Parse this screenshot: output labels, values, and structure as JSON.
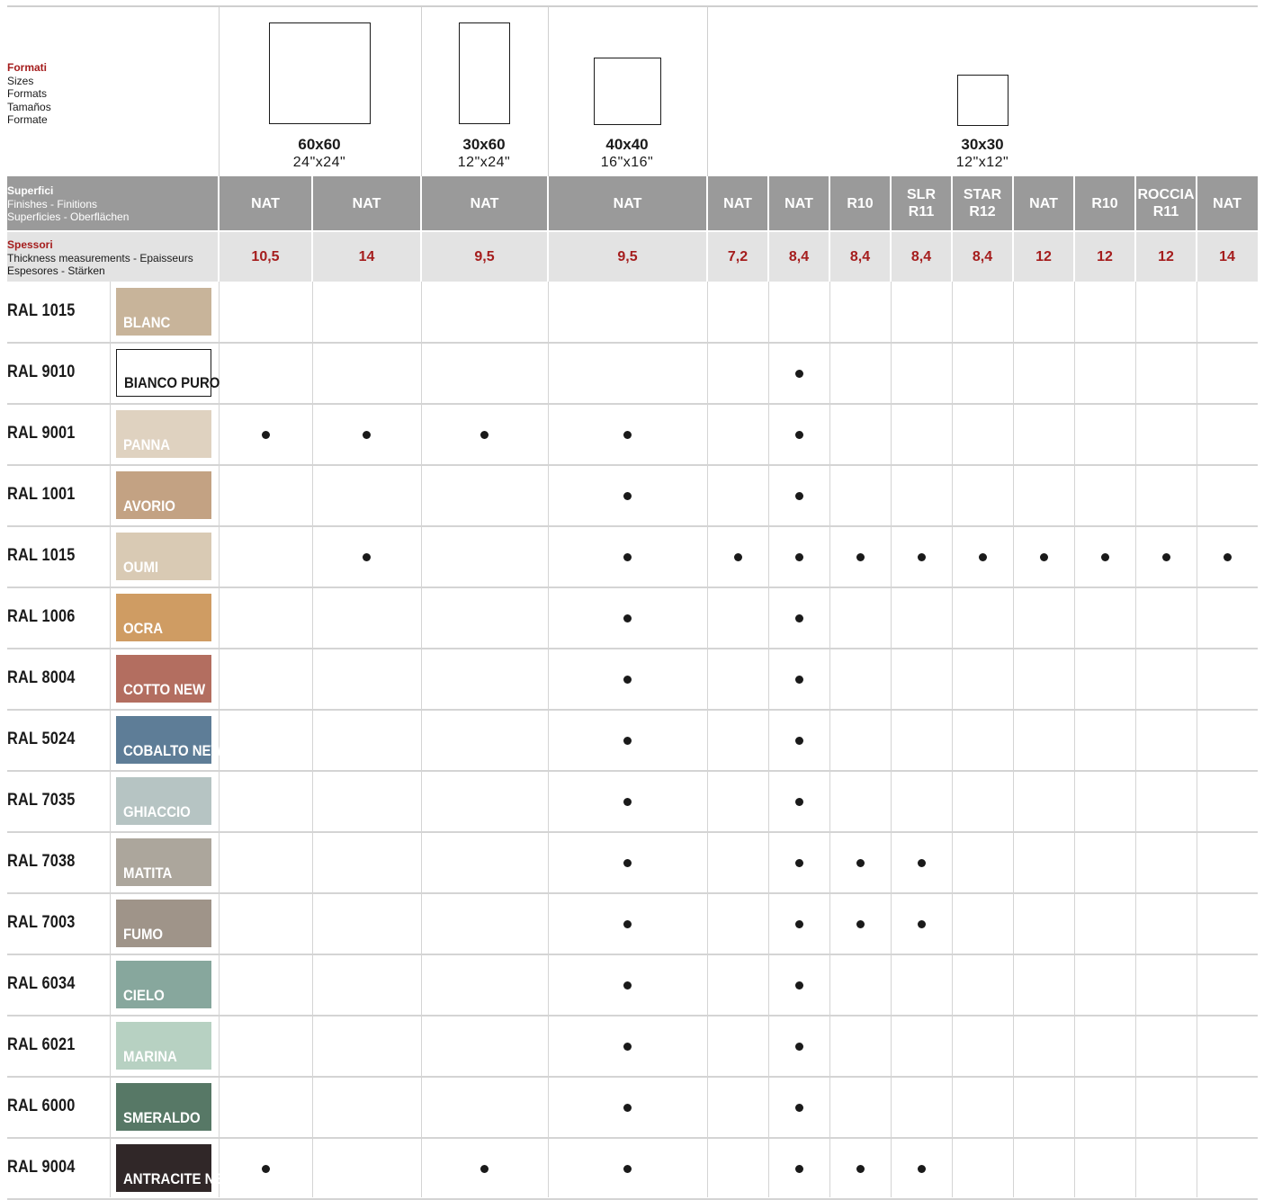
{
  "header": {
    "formats_label": [
      "Formati",
      "Sizes",
      "Formats",
      "Tamaños",
      "Formate"
    ],
    "finishes_label": [
      "Superfici",
      "Finishes - Finitions",
      "Superficies - Oberflächen"
    ],
    "thickness_label": [
      "Spessori",
      "Thickness measurements - Epaisseurs",
      "Espesores - Stärken"
    ]
  },
  "formats": [
    {
      "size": "60x60",
      "inches": "24\"x24\""
    },
    {
      "size": "30x60",
      "inches": "12\"x24\""
    },
    {
      "size": "40x40",
      "inches": "16\"x16\""
    },
    {
      "size": "30x30",
      "inches": "12\"x12\""
    }
  ],
  "columns": [
    {
      "finish": "NAT",
      "thickness": "10,5"
    },
    {
      "finish": "NAT",
      "thickness": "14"
    },
    {
      "finish": "NAT",
      "thickness": "9,5"
    },
    {
      "finish": "NAT",
      "thickness": "9,5"
    },
    {
      "finish": "NAT",
      "thickness": "7,2"
    },
    {
      "finish": "NAT",
      "thickness": "8,4"
    },
    {
      "finish": "R10",
      "thickness": "8,4"
    },
    {
      "finish": "SLR\nR11",
      "thickness": "8,4"
    },
    {
      "finish": "STAR\nR12",
      "thickness": "8,4"
    },
    {
      "finish": "NAT",
      "thickness": "12"
    },
    {
      "finish": "R10",
      "thickness": "12"
    },
    {
      "finish": "ROCCIA\nR11",
      "thickness": "12"
    },
    {
      "finish": "NAT",
      "thickness": "14"
    }
  ],
  "colors": [
    {
      "ral": "RAL 1015",
      "name": "BLANC",
      "hex": "#c8b49a",
      "available": []
    },
    {
      "ral": "RAL 9010",
      "name": "BIANCO PURO",
      "hex": "#ffffff",
      "outline": true,
      "available": [
        5
      ]
    },
    {
      "ral": "RAL 9001",
      "name": "PANNA",
      "hex": "#dfd2c0",
      "available": [
        0,
        1,
        2,
        3,
        5
      ]
    },
    {
      "ral": "RAL 1001",
      "name": "AVORIO",
      "hex": "#c3a283",
      "available": [
        3,
        5
      ]
    },
    {
      "ral": "RAL 1015",
      "name": "OUMI",
      "hex": "#d9cab4",
      "available": [
        1,
        3,
        4,
        5,
        6,
        7,
        8,
        9,
        10,
        11,
        12
      ]
    },
    {
      "ral": "RAL 1006",
      "name": "OCRA",
      "hex": "#cf9c63",
      "available": [
        3,
        5
      ]
    },
    {
      "ral": "RAL 8004",
      "name": "COTTO NEW",
      "hex": "#b36e60",
      "available": [
        3,
        5
      ]
    },
    {
      "ral": "RAL 5024",
      "name": "COBALTO NEW",
      "hex": "#5e7d97",
      "available": [
        3,
        5
      ]
    },
    {
      "ral": "RAL 7035",
      "name": "GHIACCIO",
      "hex": "#b6c4c3",
      "available": [
        3,
        5
      ]
    },
    {
      "ral": "RAL 7038",
      "name": "MATITA",
      "hex": "#aca69c",
      "available": [
        3,
        5,
        6,
        7
      ]
    },
    {
      "ral": "RAL 7003",
      "name": "FUMO",
      "hex": "#9f9489",
      "available": [
        3,
        5,
        6,
        7
      ]
    },
    {
      "ral": "RAL 6034",
      "name": "CIELO",
      "hex": "#87a79d",
      "available": [
        3,
        5
      ]
    },
    {
      "ral": "RAL 6021",
      "name": "MARINA",
      "hex": "#b7d1c2",
      "available": [
        3,
        5
      ]
    },
    {
      "ral": "RAL 6000",
      "name": "SMERALDO",
      "hex": "#577866",
      "available": [
        3,
        5
      ]
    },
    {
      "ral": "RAL 9004",
      "name": "ANTRACITE NEW",
      "hex": "#302728",
      "available": [
        0,
        2,
        3,
        5,
        6,
        7
      ]
    }
  ]
}
